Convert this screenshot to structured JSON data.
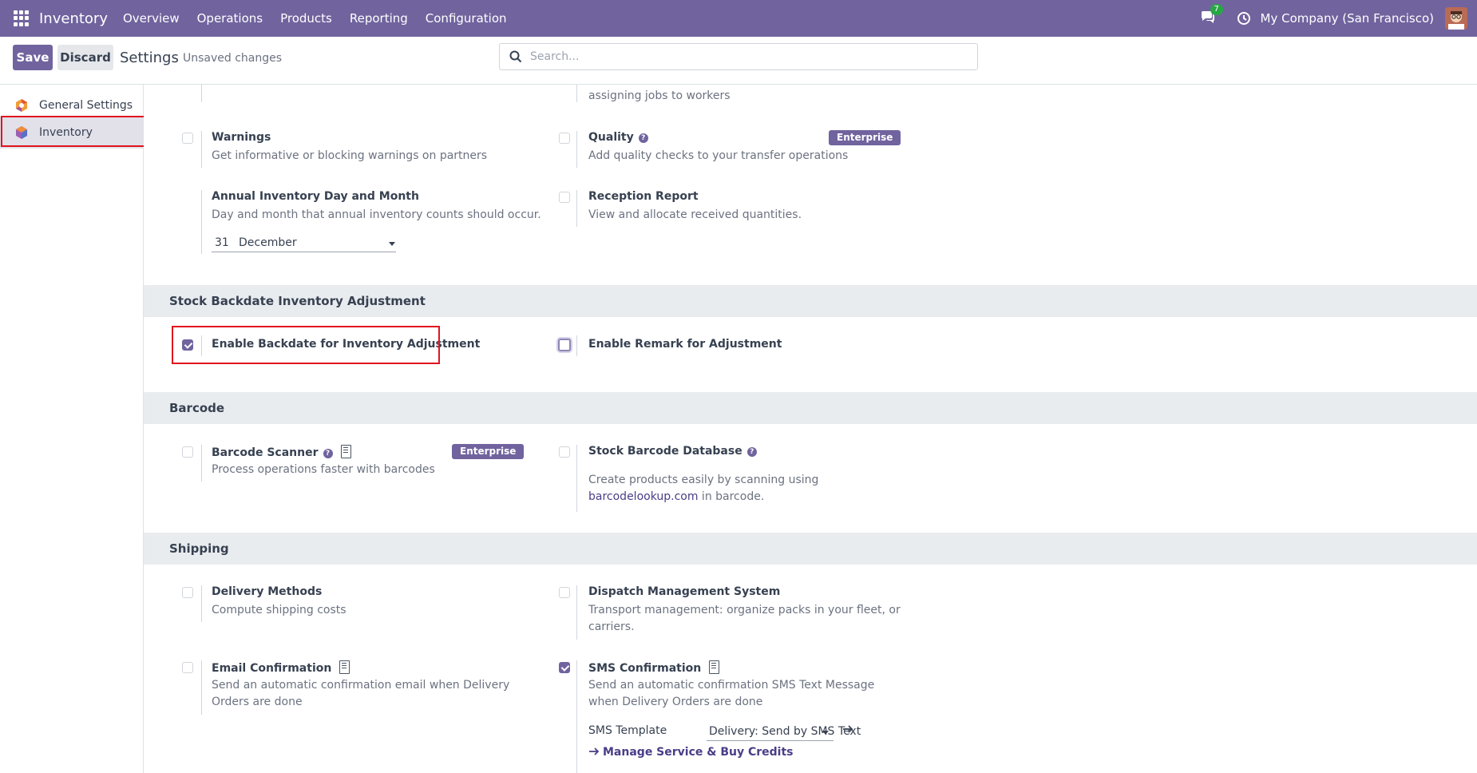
{
  "navbar": {
    "brand": "Inventory",
    "menu": [
      "Overview",
      "Operations",
      "Products",
      "Reporting",
      "Configuration"
    ],
    "chat_count": "7",
    "company": "My Company (San Francisco)"
  },
  "control": {
    "save_label": "Save",
    "discard_label": "Discard",
    "title": "Settings",
    "status": "Unsaved changes",
    "search_placeholder": "Search..."
  },
  "sidebar": {
    "items": [
      {
        "label": "General Settings"
      },
      {
        "label": "Inventory"
      }
    ]
  },
  "top_partial": {
    "right_desc_tail": "assigning jobs to workers"
  },
  "operations": {
    "warnings": {
      "title": "Warnings",
      "desc": "Get informative or blocking warnings on partners",
      "checked": false
    },
    "quality": {
      "title": "Quality",
      "desc": "Add quality checks to your transfer operations",
      "badge": "Enterprise",
      "checked": false
    },
    "annual": {
      "title": "Annual Inventory Day and Month",
      "desc": "Day and month that annual inventory counts should occur.",
      "day": "31",
      "month": "December"
    },
    "reception": {
      "title": "Reception Report",
      "desc": "View and allocate received quantities.",
      "checked": false
    }
  },
  "backdate": {
    "header": "Stock Backdate Inventory Adjustment",
    "enable_backdate": {
      "title": "Enable Backdate for Inventory Adjustment",
      "checked": true
    },
    "enable_remark": {
      "title": "Enable Remark for Adjustment",
      "checked": false
    }
  },
  "barcode": {
    "header": "Barcode",
    "scanner": {
      "title": "Barcode Scanner",
      "desc": "Process operations faster with barcodes",
      "badge": "Enterprise",
      "checked": false
    },
    "database": {
      "title": "Stock Barcode Database",
      "desc_before": "Create products easily by scanning using ",
      "desc_link": "barcodelookup.com",
      "desc_after": " in barcode.",
      "checked": false
    }
  },
  "shipping": {
    "header": "Shipping",
    "delivery": {
      "title": "Delivery Methods",
      "desc": "Compute shipping costs",
      "checked": false
    },
    "dispatch": {
      "title": "Dispatch Management System",
      "desc": "Transport management: organize packs in your fleet, or carriers.",
      "checked": false
    },
    "email": {
      "title": "Email Confirmation",
      "desc": "Send an automatic confirmation email when Delivery Orders are done",
      "checked": false
    },
    "sms": {
      "title": "SMS Confirmation",
      "desc": "Send an automatic confirmation SMS Text Message when Delivery Orders are done",
      "checked": true,
      "template_label": "SMS Template",
      "template_value": "Delivery: Send by SMS Text",
      "manage_link": "Manage Service & Buy Credits"
    }
  },
  "colors": {
    "brand": "#71639e",
    "highlight": "#e0141e",
    "badge_green": "#28a745"
  }
}
